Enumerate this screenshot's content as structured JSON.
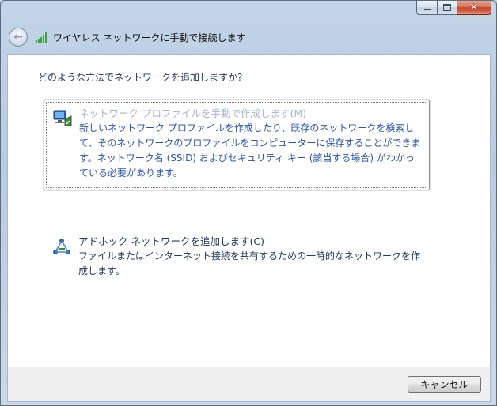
{
  "window": {
    "title": "ワイヤレス ネットワークに手動で接続します"
  },
  "caption": {
    "minimize_icon": "minimize-icon",
    "maximize_icon": "maximize-icon",
    "close_icon": "close-icon",
    "close_glyph": "✕"
  },
  "nav": {
    "back_glyph": "←"
  },
  "main": {
    "question": "どのような方法でネットワークを追加しますか?",
    "options": [
      {
        "title": "ネットワーク プロファイルを手動で作成します(M)",
        "description": "新しいネットワーク プロファイルを作成したり、既存のネットワークを検索して、そのネットワークのプロファイルをコンピューターに保存することができます。ネットワーク名 (SSID) およびセキュリティ キー (該当する場合) がわかっている必要があります。",
        "icon": "network-computer-icon"
      },
      {
        "title": "アドホック ネットワークを追加します(C)",
        "description": "ファイルまたはインターネット接続を共有するための一時的なネットワークを作成します。",
        "icon": "adhoc-network-icon"
      }
    ]
  },
  "footer": {
    "cancel_label": "キャンセル"
  },
  "colors": {
    "selected_title": "#a3b6cf",
    "selected_desc": "#2d56a8",
    "link_text": "#1e395b",
    "close_button": "#c4452b"
  }
}
